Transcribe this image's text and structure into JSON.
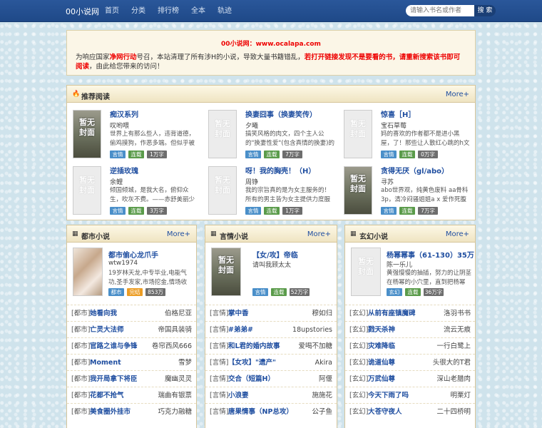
{
  "site": {
    "logo": "00小说网",
    "nav": [
      "首页",
      "分类",
      "排行榜",
      "全本",
      "轨迹"
    ],
    "search_placeholder": "请输入书名或作者",
    "search_button": "搜 索"
  },
  "notice": {
    "title": "00小说网：www.ocalapa.com",
    "line_a": "为响应国家",
    "line_b": "净网行动",
    "line_c": "号召，本站清理了所有涉H的小说，导致大量书籍错乱，",
    "line_d": "若打开链接发现不是要看的书，请重新搜索该书即可阅读",
    "line_e": "，由此给您带来的访问！"
  },
  "cover_text": "暂无\n封面",
  "recommend": {
    "title": "推荐阅读",
    "more": "More+",
    "books": [
      {
        "title": "痴汉系列",
        "author": "叹哟喂",
        "desc": "世界上有那么些人，违背道德，偷鸡摸狗，作恶多端。但似乎被称为",
        "tags": [
          "言情",
          "连载",
          "1万字"
        ],
        "cover": "img"
      },
      {
        "title": "换妻囧事（换妻笑传）",
        "author": "夕曦",
        "desc": "搞笑风格的肉文，四个主人公的\"换妻性爱\"(包含真情的换妻)的故事",
        "tags": [
          "言情",
          "连载",
          "7万字"
        ],
        "cover": "blank"
      },
      {
        "title": "惊喜［H］",
        "author": "宝石草莓",
        "desc": "妈的喜欢的作者都不是进小黑屋，了！那些让人散红心跳的h文",
        "tags": [
          "言情",
          "连载",
          "0万字"
        ],
        "cover": "blank"
      },
      {
        "title": "逆插玫瑰",
        "author": "余鲤",
        "desc": "倾国倾城，是我大名，俯仰众生，吹灰不费。——赤舒美丽少女与黑",
        "tags": [
          "言情",
          "连载",
          "3万字"
        ],
        "cover": "blank"
      },
      {
        "title": "呀！我的胸壳！（H）",
        "author": "周铮",
        "desc": "我的宗旨真的是为女主服务的！所有的男主皆为女主提供力度服务的！",
        "tags": [
          "言情",
          "连载",
          "1万字"
        ],
        "cover": "blank"
      },
      {
        "title": "贪得无厌（gl/abo）",
        "author": "寻苏",
        "desc": "abo世界观，纯黄色废料 aa骨科3p，清冷闷骚姐姐a x 爱作死腹黑",
        "tags": [
          "言情",
          "连载",
          "7万字"
        ],
        "cover": "img"
      }
    ]
  },
  "categories": [
    {
      "title": "都市小说",
      "more": "More+",
      "icon": "grid-icon",
      "feature": {
        "title": "都市偷心龙爪手",
        "author": "wtw1974",
        "desc": "19岁林天龙,中专毕业,电能气功,圣手发家,市场挖金,情场收",
        "tags": [
          "都市",
          "完结",
          "853万字"
        ],
        "cover": "photo"
      },
      "rows": [
        [
          "[都市]",
          "她看向我",
          "伯格尼亚"
        ],
        [
          "[都市]",
          "亡灵大法师",
          "帝国具装骑"
        ],
        [
          "[都市]",
          "官路之谁与争锋",
          "卷帘西风666"
        ],
        [
          "[都市]",
          "Moment",
          "雪梦"
        ],
        [
          "[都市]",
          "我开局拿下将臣",
          "魔幽灵灵"
        ],
        [
          "[都市]",
          "花都不抢气",
          "瑞曲有银票"
        ],
        [
          "[都市]",
          "美食圈外挂市",
          "巧克力融糖"
        ]
      ]
    },
    {
      "title": "言情小说",
      "more": "More+",
      "icon": "grid-icon",
      "feature": {
        "title": "【女/攻】帝临",
        "author": "请叫我顾太太",
        "desc": "",
        "tags": [
          "言情",
          "连载",
          "52万字"
        ],
        "cover": "img"
      },
      "rows": [
        [
          "[言情]",
          "掌中香",
          "穆如归"
        ],
        [
          "[言情]",
          "#弟弟#",
          "18upstories"
        ],
        [
          "[言情]",
          "和L君的婚内故事",
          "爱喝不加糖"
        ],
        [
          "[言情]",
          "【女攻】\"遗产\"",
          "Akira"
        ],
        [
          "[言情]",
          "交合（短篇H）",
          "阿偃"
        ],
        [
          "[言情]",
          "小浪妻",
          "施施花"
        ],
        [
          "[言情]",
          "唐果情事（NP总攻）",
          "公子鱼"
        ]
      ]
    },
    {
      "title": "玄幻小说",
      "more": "More+",
      "icon": "grid-icon",
      "feature": {
        "title": "杨幂幂事（61-130）35万",
        "author": "陈一乐儿",
        "desc": "黄强慢慢的抽插，努力的让阴茎在杨幂的小穴里，直到把杨幂",
        "tags": [
          "玄幻",
          "连载",
          "36万字"
        ],
        "cover": "blank"
      },
      "rows": [
        [
          "[玄幻]",
          "从前有座镇魔碑",
          "洛羽书书"
        ],
        [
          "[玄幻]",
          "戮天杀神",
          "流云无痕"
        ],
        [
          "[玄幻]",
          "灾难降临",
          "一行白鹭上"
        ],
        [
          "[玄幻]",
          "诡道仙尊",
          "头很大的T君"
        ],
        [
          "[玄幻]",
          "万武仙尊",
          "深山老腊肉"
        ],
        [
          "[玄幻]",
          "今天下雨了吗",
          "明栗灯"
        ],
        [
          "[玄幻]",
          "大苍守夜人",
          "二十四桥明"
        ]
      ]
    }
  ]
}
